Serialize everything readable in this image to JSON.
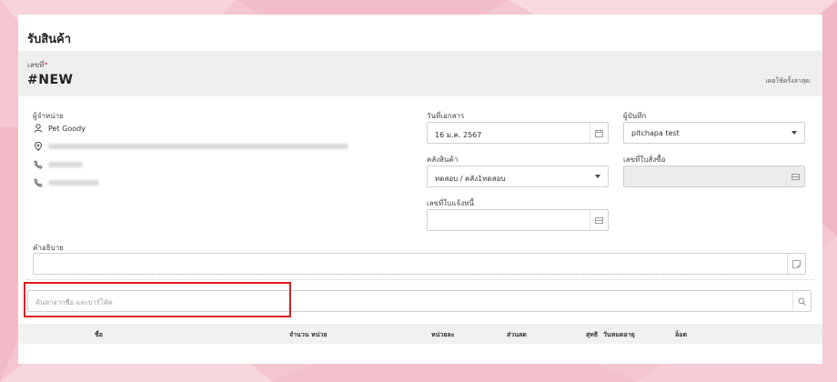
{
  "page": {
    "title": "รับสินค้า"
  },
  "header": {
    "doc_no_label": "เลขที่",
    "required_mark": "*",
    "doc_no": "#NEW",
    "last_used": "เคยใช้ครั้งล่าสุด:"
  },
  "supplier": {
    "label": "ผู้จำหน่าย",
    "name": "Pet Goody",
    "icons": [
      "user-icon",
      "location-pin-icon",
      "phone-icon",
      "phone-icon"
    ]
  },
  "form": {
    "doc_date_label": "วันที่เอกสาร",
    "doc_date_value": "16 ม.ค. 2567",
    "recorder_label": "ผู้บันทึก",
    "recorder_value": "pitchapa test",
    "warehouse_label": "คลังสินค้า",
    "warehouse_value": "ทดสอบ / คลัง1ทดสอบ",
    "po_no_label": "เลขที่ใบสั่งซื้อ",
    "invoice_no_label": "เลขที่ใบแจ้งหนี้",
    "description_label": "คำอธิบาย"
  },
  "search": {
    "placeholder": "ค้นหาจากชื่อ และบาร์โค้ด"
  },
  "table": {
    "columns": [
      "ชื่อ",
      "จำนวน",
      "หน่วย",
      "หน่วยละ",
      "ส่วนลด",
      "สุทธิ",
      "วันหมดอายุ",
      "ล็อต"
    ]
  },
  "colors": {
    "highlight": "#e0191f",
    "background": "#f4c6d0",
    "header_band": "#efefef"
  }
}
